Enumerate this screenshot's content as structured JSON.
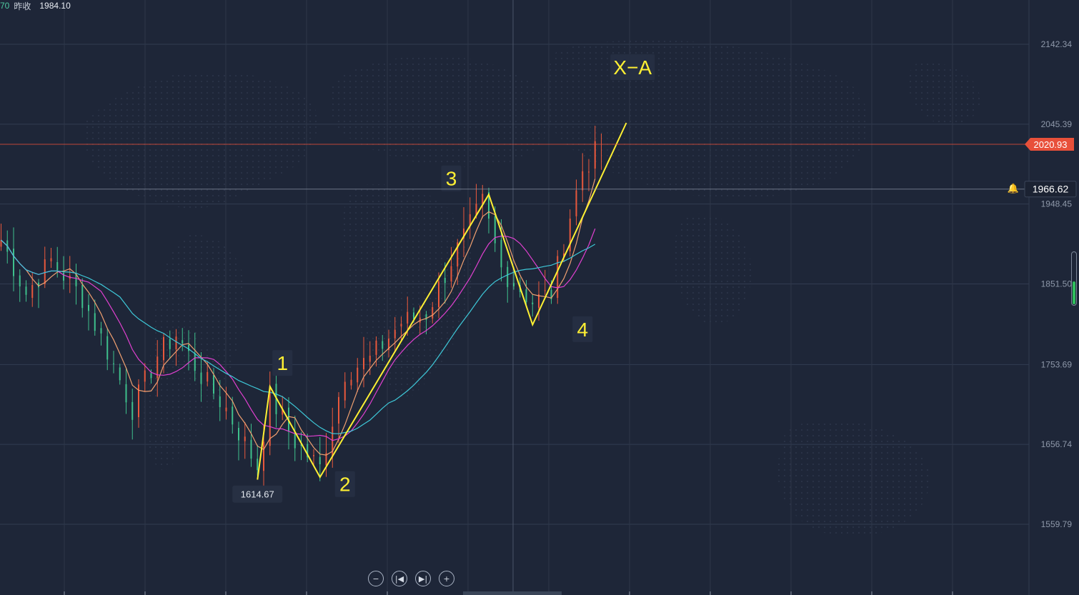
{
  "header": {
    "prefix": "70",
    "label": "昨收",
    "value": "1984.10"
  },
  "price_tags": {
    "current": "2020.93",
    "crosshair": "1966.62",
    "low_marker": "1614.67"
  },
  "colors": {
    "background": "#1e2638",
    "wave": "#fff033",
    "ma_fast": "#f0a070",
    "ma_mid": "#e040d0",
    "ma_slow": "#3ec8d8",
    "candle_up": "#e8583c",
    "candle_down": "#3ec08c",
    "current_price": "#e8503a"
  },
  "toolbar": {
    "icons": [
      "zoom-out-icon",
      "skip-back-icon",
      "skip-forward-icon",
      "zoom-in-icon"
    ]
  },
  "chart_data": {
    "type": "candlestick",
    "y_axis": {
      "position": "right",
      "ticks": [
        2142.34,
        2045.39,
        1948.45,
        1851.5,
        1753.69,
        1656.74,
        1559.79
      ],
      "tick_labels": [
        "2142.34",
        "2045.39",
        "1948.45",
        "1851.50",
        "1753.69",
        "1656.74",
        "1559.79"
      ]
    },
    "ylim": [
      1470,
      2195
    ],
    "bars": 170,
    "current_price": 2020.93,
    "crosshair_price": 1966.62,
    "low_point": {
      "bar": 41,
      "price": 1614.67
    },
    "grid": true,
    "wave_labels": [
      {
        "text": "1",
        "bar": 45,
        "price": 1753
      },
      {
        "text": "2",
        "bar": 55,
        "price": 1606
      },
      {
        "text": "3",
        "bar": 72,
        "price": 1977
      },
      {
        "text": "4",
        "bar": 93,
        "price": 1794
      },
      {
        "text": "X−A",
        "bar": 101,
        "price": 2112
      }
    ],
    "wave_path": [
      {
        "bar": 41,
        "price": 1614
      },
      {
        "bar": 43,
        "price": 1727
      },
      {
        "bar": 51,
        "price": 1617
      },
      {
        "bar": 78,
        "price": 1960
      },
      {
        "bar": 85,
        "price": 1802
      },
      {
        "bar": 100,
        "price": 2047
      }
    ],
    "key_points": [
      {
        "bar": 0,
        "price": 1905
      },
      {
        "bar": 4,
        "price": 1840
      },
      {
        "bar": 8,
        "price": 1880
      },
      {
        "bar": 13,
        "price": 1835
      },
      {
        "bar": 17,
        "price": 1770
      },
      {
        "bar": 21,
        "price": 1700
      },
      {
        "bar": 25,
        "price": 1765
      },
      {
        "bar": 28,
        "price": 1790
      },
      {
        "bar": 32,
        "price": 1740
      },
      {
        "bar": 36,
        "price": 1700
      },
      {
        "bar": 41,
        "price": 1630
      },
      {
        "bar": 43,
        "price": 1715
      },
      {
        "bar": 47,
        "price": 1660
      },
      {
        "bar": 51,
        "price": 1628
      },
      {
        "bar": 55,
        "price": 1745
      },
      {
        "bar": 59,
        "price": 1760
      },
      {
        "bar": 64,
        "price": 1805
      },
      {
        "bar": 68,
        "price": 1815
      },
      {
        "bar": 72,
        "price": 1880
      },
      {
        "bar": 77,
        "price": 1950
      },
      {
        "bar": 80,
        "price": 1870
      },
      {
        "bar": 85,
        "price": 1830
      },
      {
        "bar": 88,
        "price": 1840
      },
      {
        "bar": 91,
        "price": 1935
      },
      {
        "bar": 93,
        "price": 1990
      },
      {
        "bar": 95,
        "price": 2010
      }
    ]
  }
}
